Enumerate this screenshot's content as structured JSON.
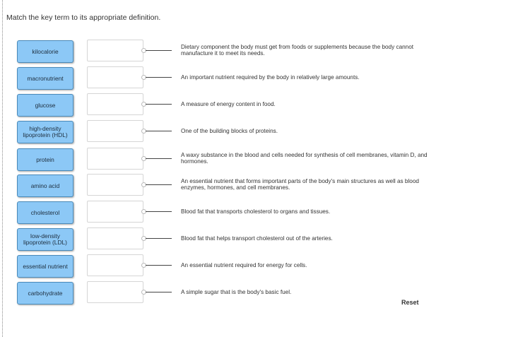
{
  "instructions": "Match the key term to its appropriate definition.",
  "terms": [
    "kilocalorie",
    "macronutrient",
    "glucose",
    "high-density lipoprotein (HDL)",
    "protein",
    "amino acid",
    "cholesterol",
    "low-density lipoprotein (LDL)",
    "essential nutrient",
    "carbohydrate"
  ],
  "definitions": [
    "Dietary component the body must get from foods or supplements because the body cannot manufacture it to meet its needs.",
    "An important nutrient required by the body in relatively large amounts.",
    "A measure of energy content in food.",
    "One of the building blocks of proteins.",
    "A waxy substance in the blood and cells needed for synthesis of cell membranes, vitamin D, and hormones.",
    "An essential nutrient that forms important parts of the body's main structures as well as blood enzymes, hormones, and cell membranes.",
    "Blood fat that transports cholesterol to organs and tissues.",
    "Blood fat that helps transport cholesterol out of the arteries.",
    "An essential nutrient required for energy for cells.",
    "A simple sugar that is the body's basic fuel."
  ],
  "reset_label": "Reset",
  "colors": {
    "term_background": "#8cc8f6",
    "term_border": "#4a8ab9"
  }
}
